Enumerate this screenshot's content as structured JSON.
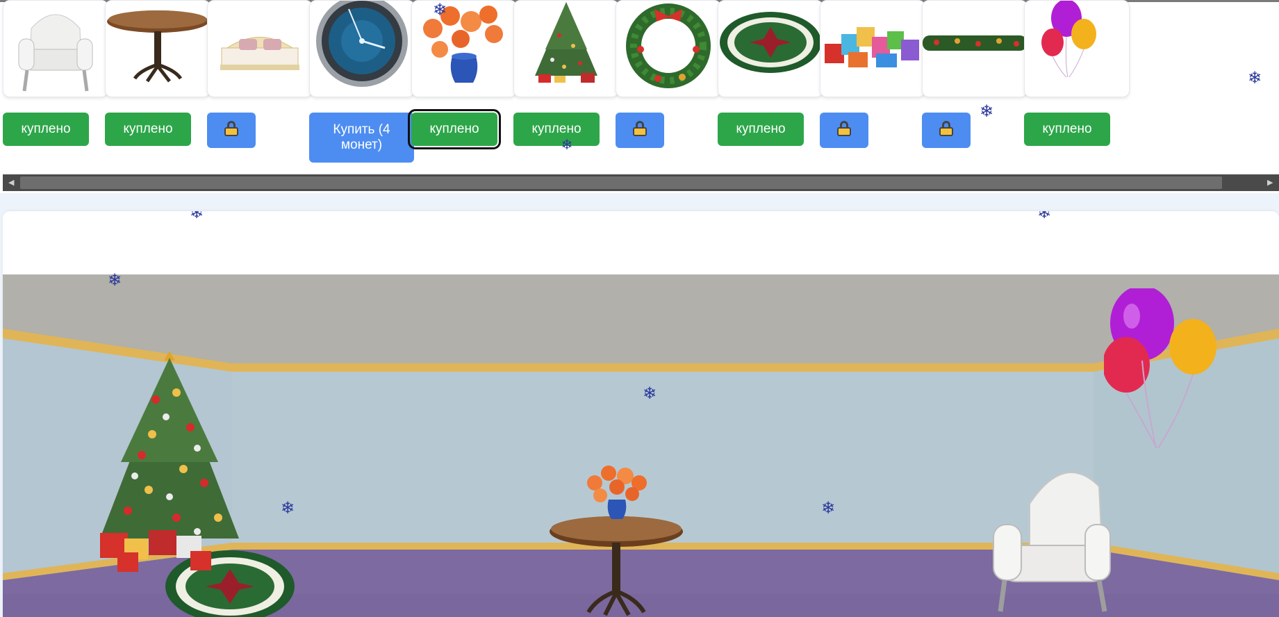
{
  "shop": {
    "items": [
      {
        "id": "armchair",
        "icon": "armchair-icon",
        "button": {
          "state": "bought",
          "label": "куплено"
        }
      },
      {
        "id": "round-table",
        "icon": "round-table-icon",
        "button": {
          "state": "bought",
          "label": "куплено"
        }
      },
      {
        "id": "bed",
        "icon": "bed-icon",
        "button": {
          "state": "locked",
          "label": ""
        }
      },
      {
        "id": "wall-clock",
        "icon": "wall-clock-icon",
        "button": {
          "state": "buy",
          "label": "Купить (4 монет)"
        }
      },
      {
        "id": "flower-vase",
        "icon": "flower-vase-icon",
        "button": {
          "state": "bought",
          "label": "куплено",
          "selected": true
        }
      },
      {
        "id": "christmas-tree",
        "icon": "christmas-tree-icon",
        "button": {
          "state": "bought",
          "label": "куплено"
        }
      },
      {
        "id": "wreath",
        "icon": "wreath-icon",
        "button": {
          "state": "locked",
          "label": ""
        }
      },
      {
        "id": "round-rug",
        "icon": "round-rug-icon",
        "button": {
          "state": "bought",
          "label": "куплено"
        }
      },
      {
        "id": "gift-boxes",
        "icon": "gift-boxes-icon",
        "button": {
          "state": "locked",
          "label": ""
        }
      },
      {
        "id": "garland",
        "icon": "garland-icon",
        "button": {
          "state": "locked",
          "label": ""
        }
      },
      {
        "id": "balloons",
        "icon": "balloons-icon",
        "button": {
          "state": "bought",
          "label": "куплено"
        }
      }
    ]
  },
  "room": {
    "placed_items": [
      "christmas-tree",
      "round-rug",
      "gift-boxes",
      "round-table",
      "flower-vase",
      "armchair",
      "balloons"
    ]
  },
  "colors": {
    "bought_button": "#2da64a",
    "locked_button": "#4d8df2",
    "wall": "#b6c9d3",
    "ceiling": "#b1b0aa",
    "trim": "#e0b557",
    "carpet": "#7d6aa0",
    "snowflake": "#2c3a9a"
  }
}
